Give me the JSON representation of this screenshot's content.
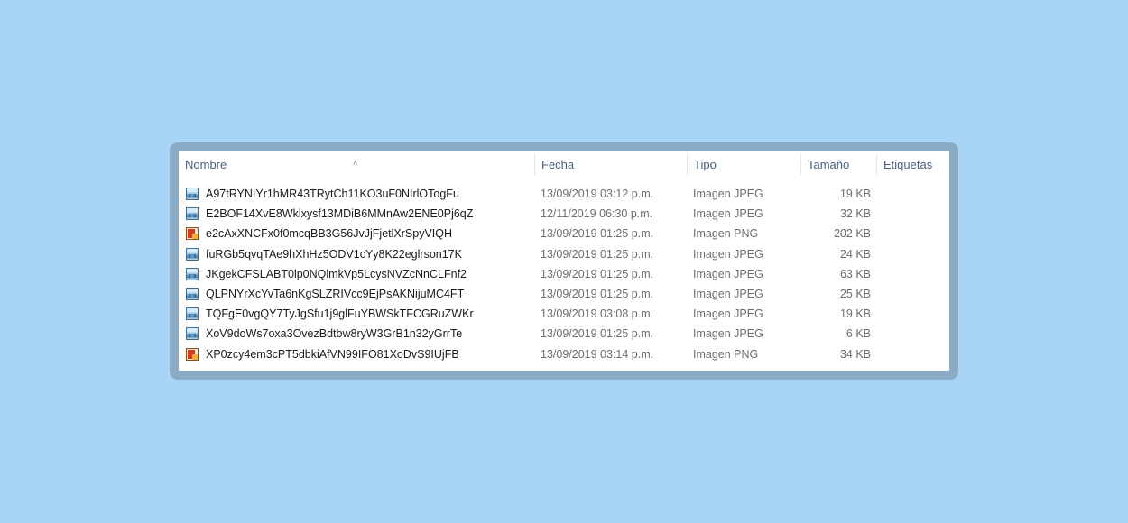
{
  "columns": {
    "name": "Nombre",
    "date": "Fecha",
    "type": "Tipo",
    "size": "Tamaño",
    "tags": "Etiquetas"
  },
  "sort_indicator": "˄",
  "files": [
    {
      "name": "A97tRYNIYr1hMR43TRytCh11KO3uF0NIrlOTogFu",
      "date": "13/09/2019 03:12 p.m.",
      "type": "Imagen JPEG",
      "size": "19 KB",
      "icon": "jpeg-file-icon"
    },
    {
      "name": "E2BOF14XvE8Wklxysf13MDiB6MMnAw2ENE0Pj6qZ",
      "date": "12/11/2019 06:30 p.m.",
      "type": "Imagen JPEG",
      "size": "32 KB",
      "icon": "jpeg-file-icon"
    },
    {
      "name": "e2cAxXNCFx0f0mcqBB3G56JvJjFjetlXrSpyVIQH",
      "date": "13/09/2019 01:25 p.m.",
      "type": "Imagen PNG",
      "size": "202 KB",
      "icon": "png-file-icon"
    },
    {
      "name": "fuRGb5qvqTAe9hXhHz5ODV1cYy8K22eglrson17K",
      "date": "13/09/2019 01:25 p.m.",
      "type": "Imagen JPEG",
      "size": "24 KB",
      "icon": "jpeg-file-icon"
    },
    {
      "name": "JKgekCFSLABT0lp0NQlmkVp5LcysNVZcNnCLFnf2",
      "date": "13/09/2019 01:25 p.m.",
      "type": "Imagen JPEG",
      "size": "63 KB",
      "icon": "jpeg-file-icon"
    },
    {
      "name": "QLPNYrXcYvTa6nKgSLZRIVcc9EjPsAKNijuMC4FT",
      "date": "13/09/2019 01:25 p.m.",
      "type": "Imagen JPEG",
      "size": "25 KB",
      "icon": "jpeg-file-icon"
    },
    {
      "name": "TQFgE0vgQY7TyJgSfu1j9glFuYBWSkTFCGRuZWKr",
      "date": "13/09/2019 03:08 p.m.",
      "type": "Imagen JPEG",
      "size": "19 KB",
      "icon": "jpeg-file-icon"
    },
    {
      "name": "XoV9doWs7oxa3OvezBdtbw8ryW3GrB1n32yGrrTe",
      "date": "13/09/2019 01:25 p.m.",
      "type": "Imagen JPEG",
      "size": "6 KB",
      "icon": "jpeg-file-icon"
    },
    {
      "name": "XP0zcy4em3cPT5dbkiAfVN99IFO81XoDvS9IUjFB",
      "date": "13/09/2019 03:14 p.m.",
      "type": "Imagen PNG",
      "size": "34 KB",
      "icon": "png-file-icon"
    }
  ]
}
